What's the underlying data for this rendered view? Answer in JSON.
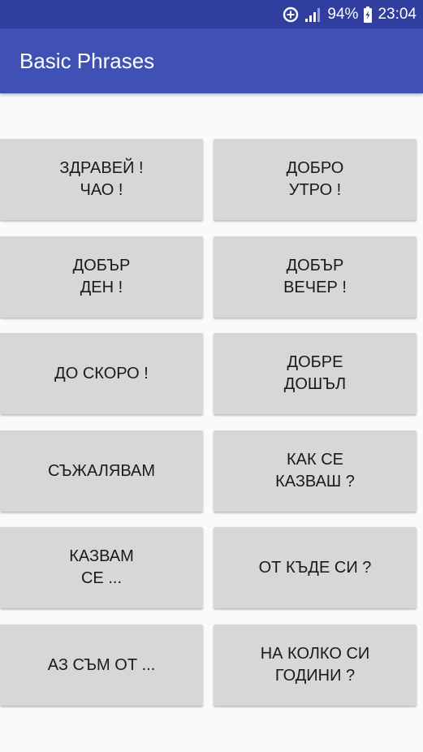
{
  "status_bar": {
    "battery": "94%",
    "time": "23:04",
    "icons": [
      "data-saver-icon",
      "signal-icon",
      "battery-charging-icon"
    ]
  },
  "app_bar": {
    "title": "Basic Phrases"
  },
  "phrases": [
    "ЗДРАВЕЙ !\nЧАО !",
    "ДОБРО\nУТРО !",
    "ДОБЪР\nДЕН !",
    "ДОБЪР\nВЕЧЕР !",
    "ДО СКОРО !",
    "ДОБРЕ\nДОШЪЛ",
    "СЪЖАЛЯВАМ",
    "КАК СЕ\nКАЗВАШ ?",
    "КАЗВАМ\nСЕ ...",
    "ОТ КЪДЕ СИ ?",
    "АЗ СЪМ ОТ ...",
    "НА КОЛКО СИ\nГОДИНИ ?"
  ],
  "colors": {
    "status_bar": "#303f9f",
    "app_bar": "#3f51b5",
    "button_bg": "#d6d7d7",
    "page_bg": "#fafafa"
  }
}
